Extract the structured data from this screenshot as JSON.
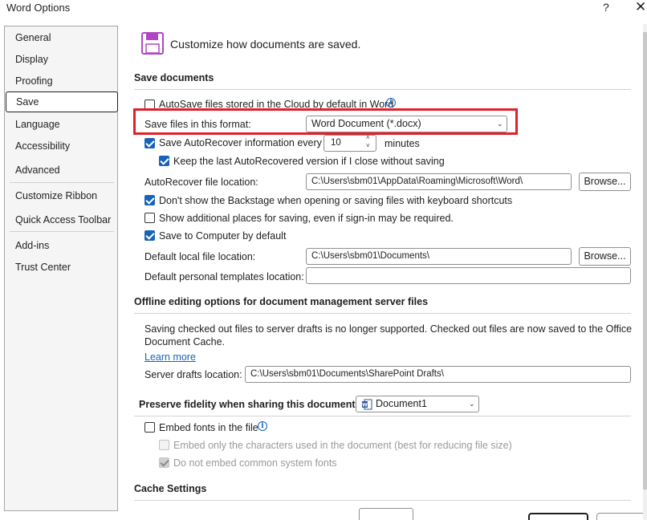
{
  "window": {
    "title": "Word Options",
    "help_label": "?",
    "close_label": "✕"
  },
  "sidebar": {
    "items": [
      {
        "label": "General"
      },
      {
        "label": "Display"
      },
      {
        "label": "Proofing"
      },
      {
        "label": "Save",
        "selected": true
      },
      {
        "label": "Language"
      },
      {
        "label": "Accessibility"
      },
      {
        "label": "Advanced"
      },
      {
        "label": "Customize Ribbon"
      },
      {
        "label": "Quick Access Toolbar"
      },
      {
        "label": "Add-ins"
      },
      {
        "label": "Trust Center"
      }
    ]
  },
  "header": {
    "text": "Customize how documents are saved.",
    "icon": "save-floppy-icon",
    "icon_color": "#b146c2"
  },
  "save_documents": {
    "heading": "Save documents",
    "autosave_label": "AutoSave files stored in the Cloud by default in Word",
    "autosave_checked": false,
    "format_label": "Save files in this format:",
    "format_value": "Word Document (*.docx)",
    "autorecover_label": "Save AutoRecover information every",
    "autorecover_checked": true,
    "autorecover_minutes": "10",
    "minutes_label": "minutes",
    "keep_last_label": "Keep the last AutoRecovered version if I close without saving",
    "keep_last_checked": true,
    "autorecover_location_label": "AutoRecover file location:",
    "autorecover_location_value": "C:\\Users\\sbm01\\AppData\\Roaming\\Microsoft\\Word\\",
    "browse_label": "Browse...",
    "backstage_label": "Don't show the Backstage when opening or saving files with keyboard shortcuts",
    "backstage_checked": true,
    "additional_places_label": "Show additional places for saving, even if sign-in may be required.",
    "additional_places_checked": false,
    "save_to_computer_label": "Save to Computer by default",
    "save_to_computer_checked": true,
    "default_local_label": "Default local file location:",
    "default_local_value": "C:\\Users\\sbm01\\Documents\\",
    "browse2_label": "Browse...",
    "templates_label": "Default personal templates location:",
    "templates_value": ""
  },
  "offline": {
    "heading": "Offline editing options for document management server files",
    "notice_line1": "Saving checked out files to server drafts is no longer supported. Checked out files are now saved to the Office",
    "notice_line2": "Document Cache.",
    "learn_more": "Learn more",
    "server_drafts_label": "Server drafts location:",
    "server_drafts_value": "C:\\Users\\sbm01\\Documents\\SharePoint Drafts\\"
  },
  "fidelity": {
    "heading": "Preserve fidelity when sharing this document:",
    "document_value": "Document1",
    "embed_fonts_label": "Embed fonts in the file",
    "embed_fonts_checked": false,
    "embed_only_label": "Embed only the characters used in the document (best for reducing file size)",
    "embed_only_checked": false,
    "no_common_label": "Do not embed common system fonts",
    "no_common_checked": true
  },
  "cache": {
    "heading": "Cache Settings"
  },
  "colors": {
    "accent": "#1763b9",
    "highlight_box": "#e0202a"
  }
}
